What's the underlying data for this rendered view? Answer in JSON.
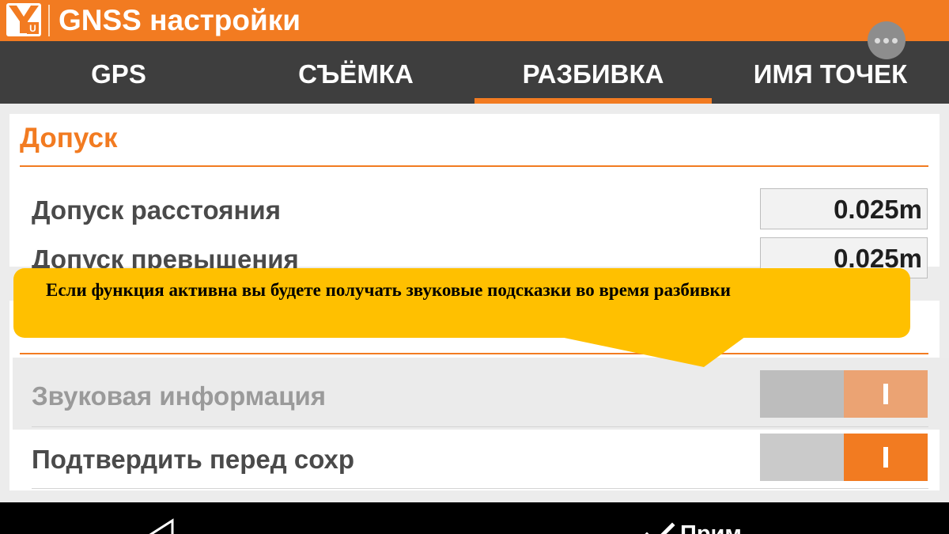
{
  "app": {
    "title": "GNSS настройки",
    "logo_icon": "app-logo-icon",
    "brand_color": "#f27b21"
  },
  "tabs": [
    {
      "label": "GPS",
      "active": false
    },
    {
      "label": "СЪЁМКА",
      "active": false
    },
    {
      "label": "РАЗБИВКА",
      "active": true
    },
    {
      "label": "ИМЯ ТОЧЕК",
      "active": false
    }
  ],
  "tolerance": {
    "title": "Допуск",
    "distance_label": "Допуск расстояния",
    "distance_value": "0.025m",
    "height_label": "Допуск превышения",
    "height_value": "0.025m"
  },
  "settings": {
    "sound_label": "Звуковая информация",
    "sound_enabled": true,
    "sound_disabled_look": true,
    "confirm_label": "Подтвердить перед сохр",
    "confirm_enabled": true
  },
  "callout": {
    "text": "Если функция активна вы будете получать звуковые подсказки во время разбивки",
    "color": "#ffc000"
  },
  "navbar": {
    "back_icon": "back-triangle-icon",
    "apply_icon": "checkmark-icon",
    "apply_label": "Прим"
  }
}
